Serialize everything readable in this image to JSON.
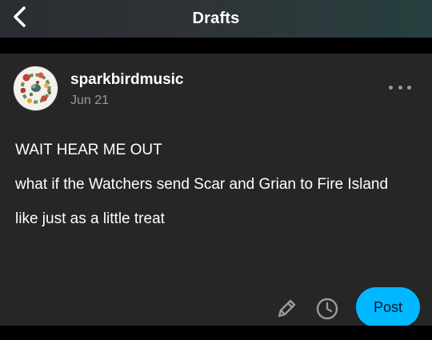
{
  "header": {
    "title": "Drafts",
    "back_icon": "chevron-left-icon"
  },
  "post": {
    "blog_name": "sparkbirdmusic",
    "date": "Jun 21",
    "menu_icon": "more-horizontal-icon",
    "paragraphs": [
      "WAIT HEAR ME OUT",
      "what if the Watchers send Scar and Grian to Fire Island",
      "like just as a little treat"
    ]
  },
  "actions": {
    "edit_icon": "pencil-icon",
    "schedule_icon": "clock-icon",
    "post_label": "Post"
  },
  "colors": {
    "card_bg": "#262626",
    "accent": "#00b8ff",
    "muted_text": "#9a9a9a"
  }
}
